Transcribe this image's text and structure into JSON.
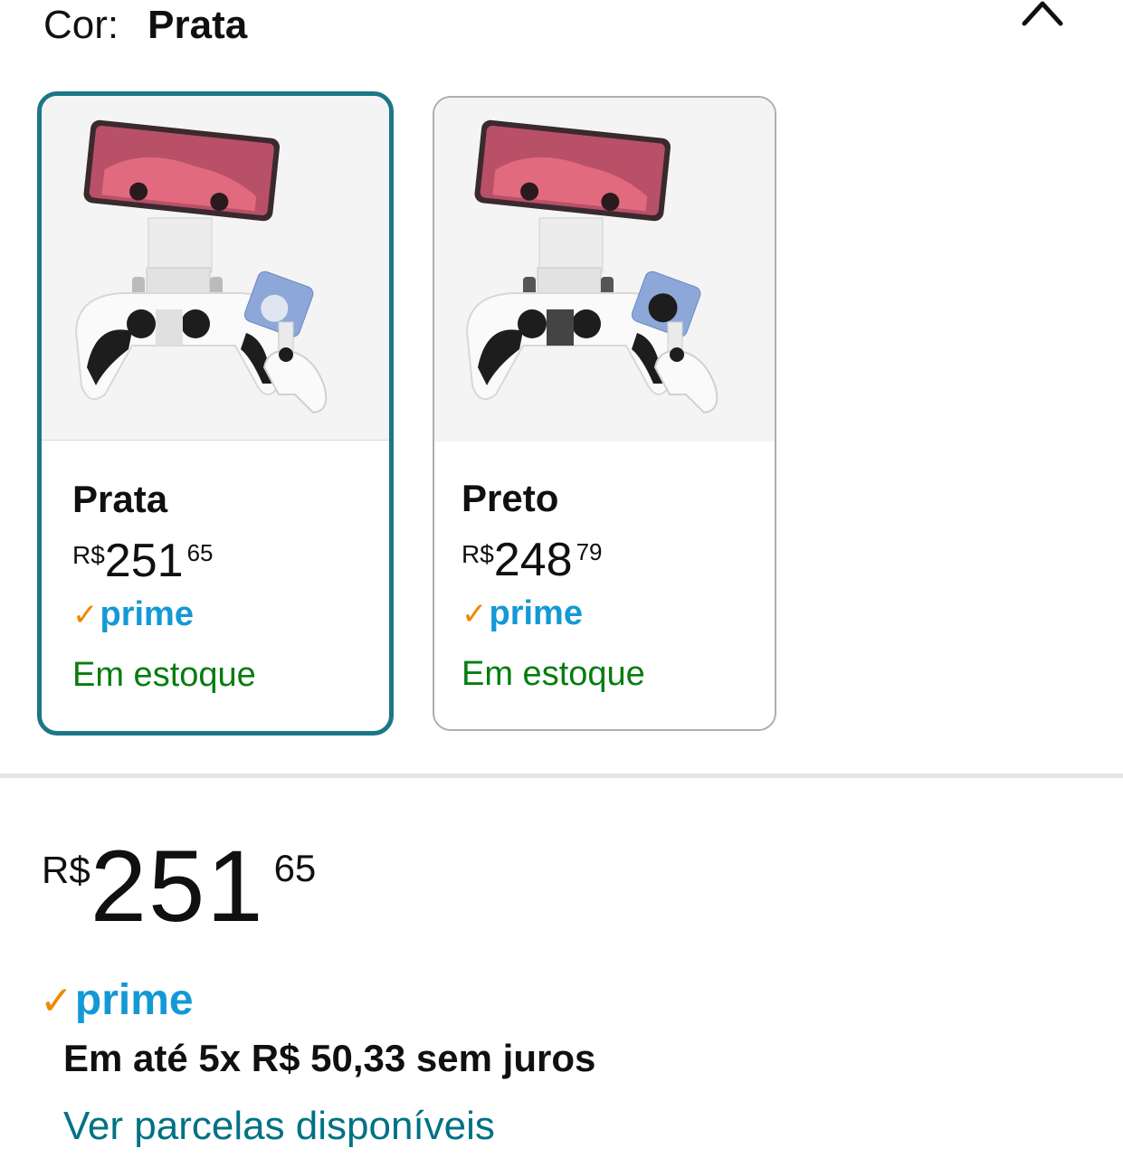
{
  "color_selector": {
    "label": "Cor:",
    "selected_value": "Prata"
  },
  "swatches": [
    {
      "name": "Prata",
      "price_currency": "R$",
      "price_whole": "251",
      "price_fraction": "65",
      "prime_check": "✓",
      "prime_text": "prime",
      "stock": "Em estoque",
      "selected": true
    },
    {
      "name": "Preto",
      "price_currency": "R$",
      "price_whole": "248",
      "price_fraction": "79",
      "prime_check": "✓",
      "prime_text": "prime",
      "stock": "Em estoque",
      "selected": false
    }
  ],
  "price": {
    "currency": "R$",
    "whole": "251",
    "fraction": "65"
  },
  "prime": {
    "check": "✓",
    "text": "prime"
  },
  "installments": {
    "text": "Em até 5x R$ 50,33 sem juros",
    "link_text": "Ver parcelas disponíveis"
  },
  "colors": {
    "selected_border": "#1d7687",
    "prime_blue": "#1399d5",
    "prime_check": "#f08804",
    "stock_green": "#067d0e",
    "link_teal": "#007185"
  },
  "icons": {
    "collapse": "chevron-up-icon"
  }
}
